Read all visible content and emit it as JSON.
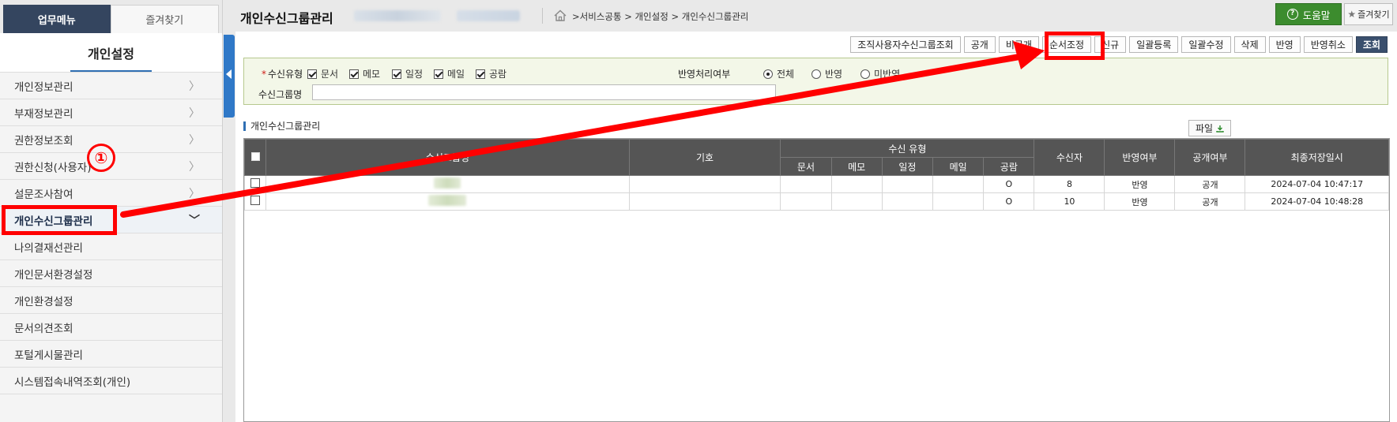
{
  "sidebar": {
    "tabs": [
      {
        "label": "업무메뉴",
        "active": true
      },
      {
        "label": "즐겨찾기",
        "active": false
      }
    ],
    "title": "개인설정",
    "items": [
      {
        "label": "개인정보관리"
      },
      {
        "label": "부재정보관리"
      },
      {
        "label": "권한정보조회"
      },
      {
        "label": "권한신청(사용자)"
      },
      {
        "label": "설문조사참여"
      },
      {
        "label": "개인수신그룹관리",
        "selected": true
      },
      {
        "label": "나의결재선관리"
      },
      {
        "label": "개인문서환경설정"
      },
      {
        "label": "개인환경설정"
      },
      {
        "label": "문서의견조회"
      },
      {
        "label": "포털게시물관리"
      },
      {
        "label": "시스템접속내역조회(개인)"
      }
    ]
  },
  "header": {
    "title": "개인수신그룹관리",
    "breadcrumb": ">서비스공통 > 개인설정 > 개인수신그룹관리",
    "help_label": "도움말",
    "favorite_label": "즐겨찾기"
  },
  "toolbar": {
    "buttons": [
      "조직사용자수신그룹조회",
      "공개",
      "비공개",
      "순서조정",
      "신규",
      "일괄등록",
      "일괄수정",
      "삭제",
      "반영",
      "반영취소",
      "조회"
    ]
  },
  "search": {
    "type_label": "수신유형",
    "required_mark": "*",
    "type_options": [
      {
        "label": "문서",
        "checked": true
      },
      {
        "label": "메모",
        "checked": true
      },
      {
        "label": "일정",
        "checked": true
      },
      {
        "label": "메일",
        "checked": true
      },
      {
        "label": "공람",
        "checked": true
      }
    ],
    "reflect_label": "반영처리여부",
    "reflect_options": [
      {
        "label": "전체",
        "selected": true
      },
      {
        "label": "반영",
        "selected": false
      },
      {
        "label": "미반영",
        "selected": false
      }
    ],
    "name_label": "수신그룹명",
    "name_value": ""
  },
  "grid": {
    "section_title": "개인수신그룹관리",
    "file_button": "파일",
    "columns": {
      "name": "수신그룹명",
      "code": "기호",
      "type_group": "수신 유형",
      "types": [
        "문서",
        "메모",
        "일정",
        "메일",
        "공람"
      ],
      "recipients": "수신자",
      "reflect": "반영여부",
      "public": "공개여부",
      "saved": "최종저장일시"
    },
    "rows": [
      {
        "name": "",
        "code": "",
        "doc": "",
        "memo": "",
        "schedule": "",
        "mail": "",
        "circular": "O",
        "recipients": "8",
        "reflect": "반영",
        "public": "공개",
        "saved": "2024-07-04 10:47:17"
      },
      {
        "name": "",
        "code": "",
        "doc": "",
        "memo": "",
        "schedule": "",
        "mail": "",
        "circular": "O",
        "recipients": "10",
        "reflect": "반영",
        "public": "공개",
        "saved": "2024-07-04 10:48:28"
      }
    ]
  },
  "annotation": {
    "step_label": "①",
    "color": "#ff0000"
  }
}
